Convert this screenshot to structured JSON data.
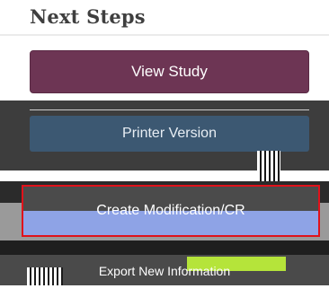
{
  "section": {
    "title": "Next Steps"
  },
  "buttons": {
    "view_study": "View Study",
    "printer_version": "Printer Version",
    "create_modification": "Create Modification/CR",
    "export": "Export New Information"
  },
  "colors": {
    "view_button_bg": "#6d3554",
    "printer_button_bg": "#3c5872",
    "highlight_border": "#e0121b"
  }
}
